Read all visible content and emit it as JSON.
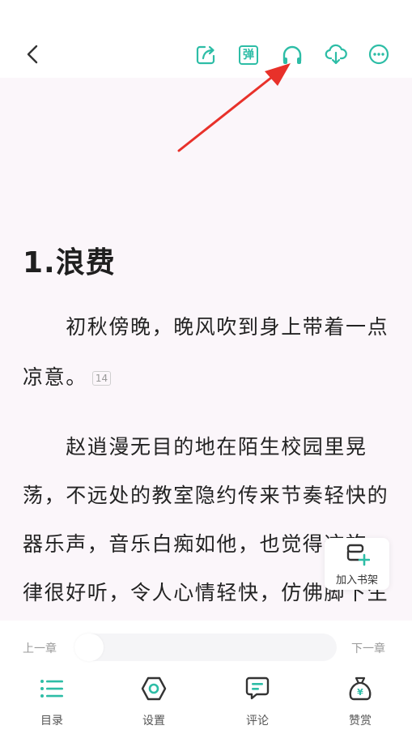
{
  "toolbar": {
    "back_icon": "chevron-left-icon",
    "share_icon": "share-icon",
    "danmaku_label": "弹",
    "listen_icon": "headphones-icon",
    "download_icon": "cloud-download-icon",
    "more_icon": "more-icon"
  },
  "chapter": {
    "title": "1.浪费",
    "lines": [
      "　　初秋傍晚，晚风吹到身上带着一点",
      "凉意。",
      "　　赵逍漫无目的地在陌生校园里晃",
      "荡，不远处的教室隐约传来节奏轻快的",
      "器乐声，音乐白痴如他，也觉得这旋",
      "律很好听，令人心情轻快，仿佛脚下生"
    ],
    "comment_count": "14"
  },
  "shelf": {
    "label": "加入书架"
  },
  "progress": {
    "prev_label": "上一章",
    "next_label": "下一章",
    "value": 0
  },
  "nav": {
    "items": [
      {
        "label": "目录",
        "icon": "list-icon"
      },
      {
        "label": "设置",
        "icon": "settings-hexagon-icon"
      },
      {
        "label": "评论",
        "icon": "comment-icon"
      },
      {
        "label": "赞赏",
        "icon": "reward-bag-icon"
      }
    ]
  },
  "colors": {
    "accent": "#2dbda6",
    "reader_bg": "#fbf6fa",
    "arrow": "#e8312a"
  }
}
